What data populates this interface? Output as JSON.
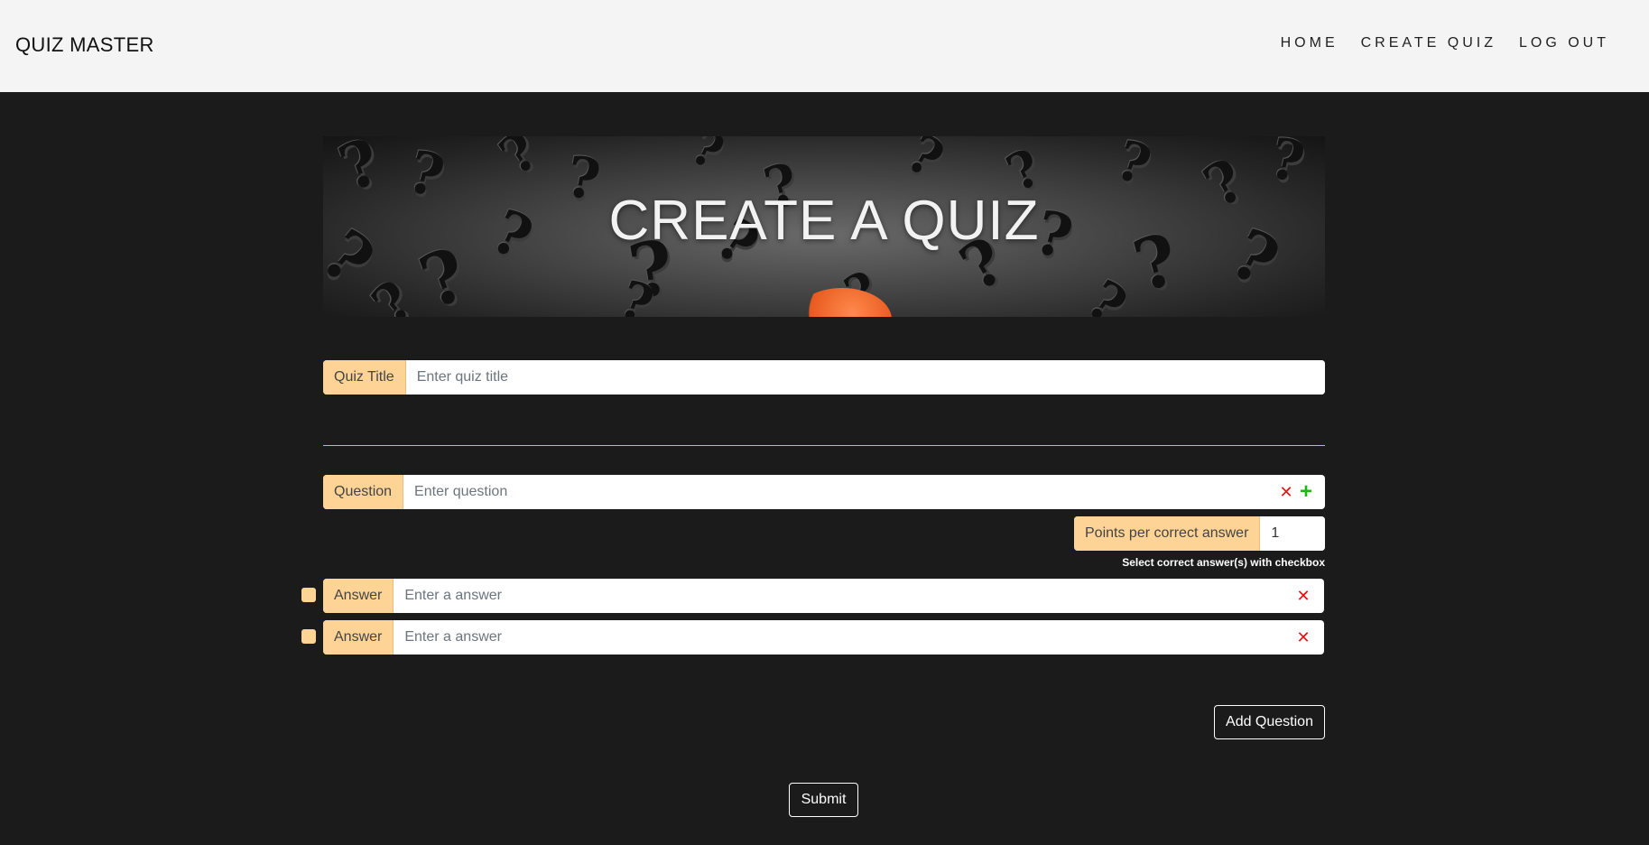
{
  "navbar": {
    "brand": "QUIZ MASTER",
    "links": [
      "HOME",
      "CREATE QUIZ",
      "LOG OUT"
    ]
  },
  "hero": {
    "title": "CREATE A QUIZ"
  },
  "quiz_title": {
    "label": "Quiz Title",
    "placeholder": "Enter quiz title",
    "value": ""
  },
  "question": {
    "label": "Question",
    "placeholder": "Enter question",
    "value": "",
    "remove_icon": "close-icon",
    "add_icon": "plus-icon"
  },
  "points": {
    "label": "Points per correct answer",
    "value": "1"
  },
  "hint": "Select correct answer(s) with checkbox",
  "answers": [
    {
      "label": "Answer",
      "placeholder": "Enter a answer",
      "value": "",
      "checked": false
    },
    {
      "label": "Answer",
      "placeholder": "Enter a answer",
      "value": "",
      "checked": false
    }
  ],
  "buttons": {
    "add_question": "Add Question",
    "submit": "Submit"
  },
  "colors": {
    "accent": "#fed496",
    "background": "#1b1b1b",
    "navbar": "#f4f4f4",
    "remove": "#e01414",
    "add": "#18b818"
  }
}
